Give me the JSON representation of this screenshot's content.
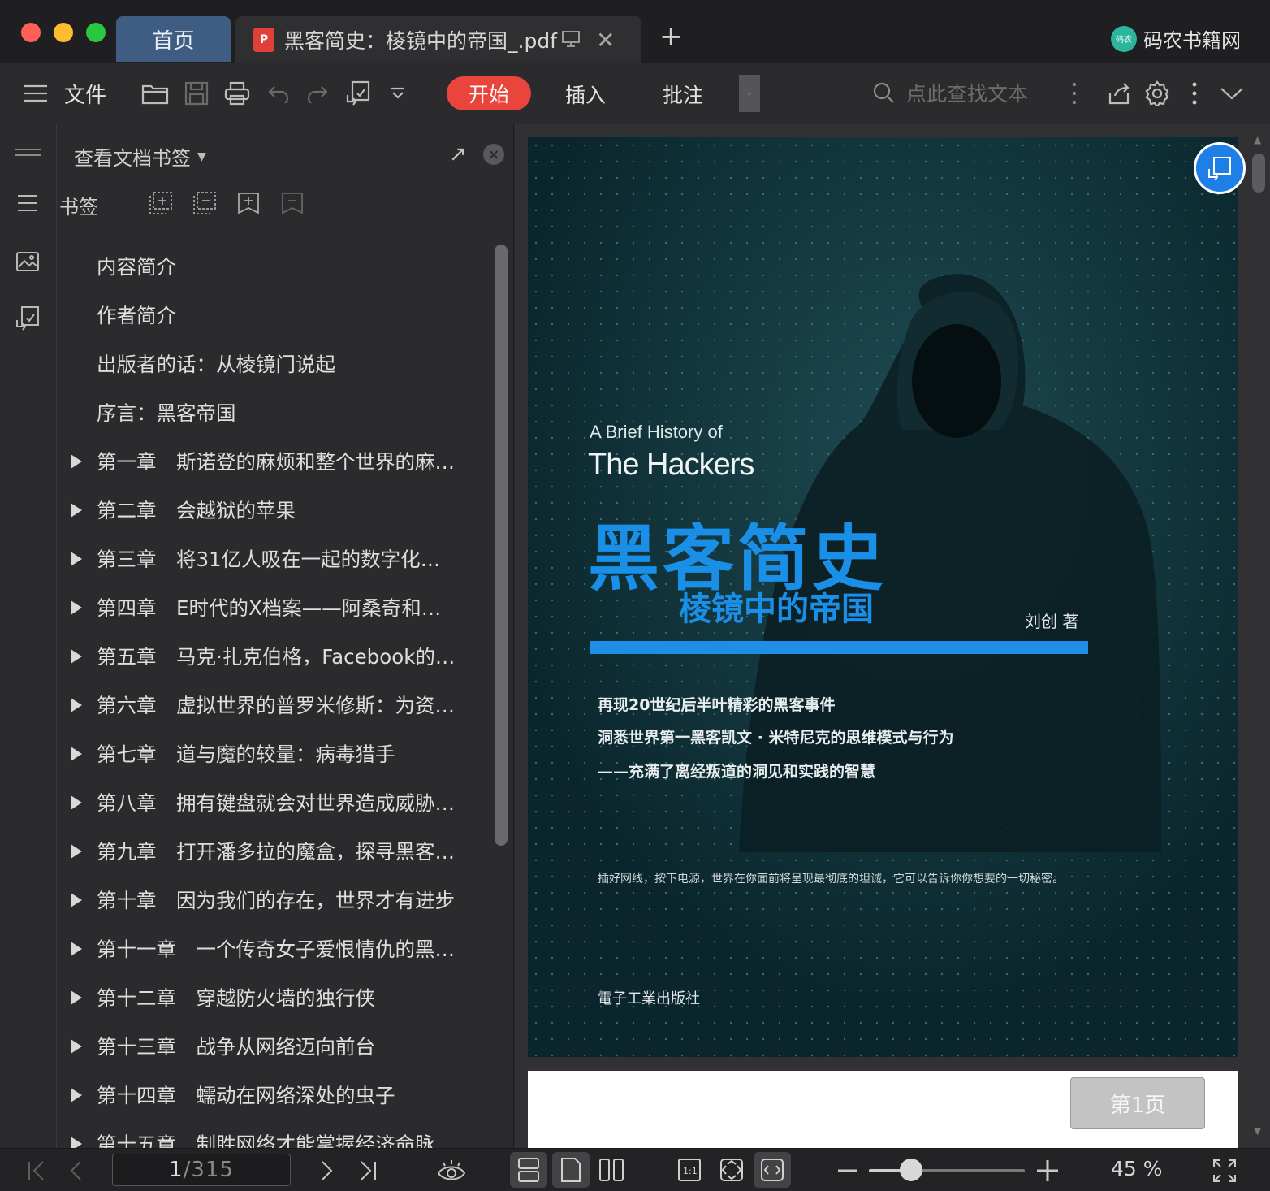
{
  "window": {
    "traffic_lights": [
      "#fe5f57",
      "#febc2e",
      "#28c840"
    ],
    "tabs": [
      {
        "label": "首页",
        "active": false
      },
      {
        "label": "黑客简史：棱镜中的帝国_.pdf",
        "active": true
      }
    ],
    "new_tab_icon": "plus-icon",
    "brand": {
      "name": "码农书籍网",
      "logo_text": "码农"
    }
  },
  "toolbar": {
    "menu_label": "文件",
    "ribbon_tabs": [
      "开始",
      "插入",
      "批注"
    ],
    "search_placeholder": "点此查找文本",
    "accent": "#e9453d"
  },
  "bookmark_panel": {
    "header": "查看文档书签",
    "section_label": "书签",
    "items": [
      {
        "text": "内容简介",
        "expandable": false
      },
      {
        "text": "作者简介",
        "expandable": false
      },
      {
        "text": "出版者的话：从棱镜门说起",
        "expandable": false
      },
      {
        "text": "序言：黑客帝国",
        "expandable": false
      },
      {
        "text": "第一章　斯诺登的麻烦和整个世界的麻…",
        "expandable": true
      },
      {
        "text": "第二章　会越狱的苹果",
        "expandable": true
      },
      {
        "text": "第三章　将31亿人吸在一起的数字化…",
        "expandable": true
      },
      {
        "text": "第四章　E时代的X档案——阿桑奇和…",
        "expandable": true
      },
      {
        "text": "第五章　马克·扎克伯格，Facebook的…",
        "expandable": true
      },
      {
        "text": "第六章　虚拟世界的普罗米修斯：为资…",
        "expandable": true
      },
      {
        "text": "第七章　道与魔的较量：病毒猎手",
        "expandable": true
      },
      {
        "text": "第八章　拥有键盘就会对世界造成威胁…",
        "expandable": true
      },
      {
        "text": "第九章　打开潘多拉的魔盒，探寻黑客…",
        "expandable": true
      },
      {
        "text": "第十章　因为我们的存在，世界才有进步",
        "expandable": true
      },
      {
        "text": "第十一章　一个传奇女子爱恨情仇的黑…",
        "expandable": true
      },
      {
        "text": "第十二章　穿越防火墙的独行侠",
        "expandable": true
      },
      {
        "text": "第十三章　战争从网络迈向前台",
        "expandable": true
      },
      {
        "text": "第十四章　蠕动在网络深处的虫子",
        "expandable": true
      },
      {
        "text": "第十五章　制胜网络才能掌握经济命脉",
        "expandable": true
      }
    ]
  },
  "document": {
    "cover": {
      "subtitle_en_1": "A Brief History of",
      "subtitle_en_2": "The Hackers",
      "title": "黑客简史",
      "subtitle": "棱镜中的帝国",
      "author": "刘创 著",
      "lines": [
        "再现20世纪后半叶精彩的黑客事件",
        "洞悉世界第一黑客凯文 · 米特尼克的思维模式与行为",
        "——充满了离经叛道的洞见和实践的智慧"
      ],
      "footer": "插好网线，按下电源，世界在你面前将呈现最彻底的坦诚，它可以告诉你你想要的一切秘密。",
      "publisher": "電子工業出版社",
      "colors": {
        "background": "#0e2f36",
        "title": "#1a8fe8"
      }
    },
    "page_badge": "第1页"
  },
  "statusbar": {
    "current_page": "1",
    "total_pages": "/315",
    "zoom_percent": 45,
    "zoom_label": "45 %"
  }
}
